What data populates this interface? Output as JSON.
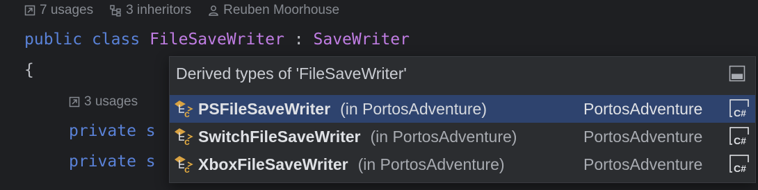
{
  "hints_top": {
    "usages": "7 usages",
    "inheritors": "3 inheritors",
    "author": "Reuben Moorhouse",
    "usages_icon": "link-arrow-icon",
    "inheritors_icon": "hierarchy-icon",
    "author_icon": "person-icon"
  },
  "code": {
    "decl_keyword1": "public",
    "decl_keyword2": "class",
    "class_name": "FileSaveWriter",
    "separator": ":",
    "base_class": "SaveWriter",
    "brace": "{",
    "member_keyword": "private",
    "member_partial": "s"
  },
  "hints_inner": {
    "usages": "3 usages"
  },
  "popup": {
    "title": "Derived types of 'FileSaveWriter'",
    "pin_icon": "pin-window-icon",
    "items": [
      {
        "name": "PSFileSaveWriter",
        "namespace": "(in PortosAdventure)",
        "module": "PortosAdventure",
        "selected": true
      },
      {
        "name": "SwitchFileSaveWriter",
        "namespace": "(in PortosAdventure)",
        "module": "PortosAdventure",
        "selected": false
      },
      {
        "name": "XboxFileSaveWriter",
        "namespace": "(in PortosAdventure)",
        "module": "PortosAdventure",
        "selected": false
      }
    ],
    "project_icon_label": "C#"
  },
  "colors": {
    "background": "#1e1f22",
    "keyword": "#5a82d8",
    "class_name": "#c07de3",
    "popup_bg": "#2b2d30",
    "selection": "#2e436e"
  }
}
